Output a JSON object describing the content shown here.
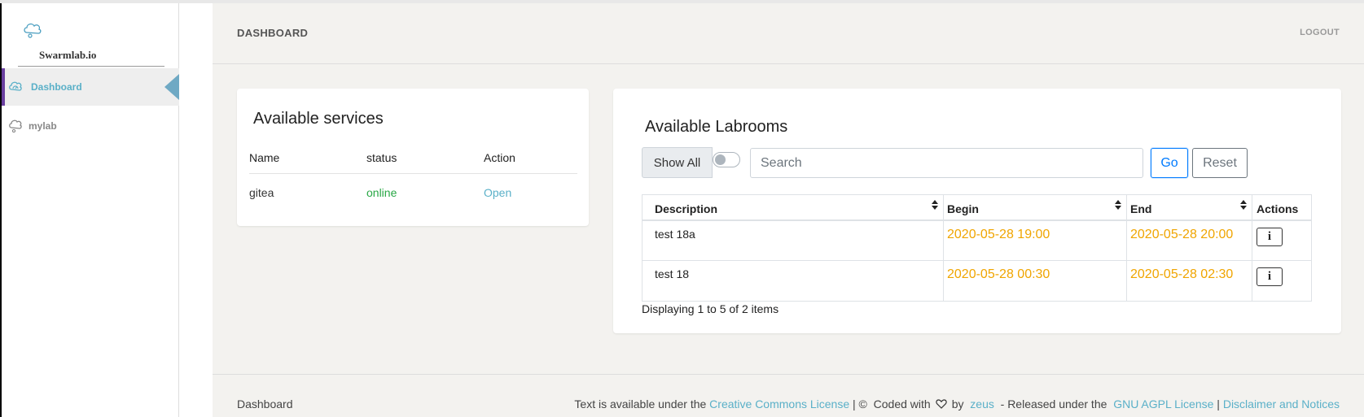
{
  "sidebar": {
    "brand": "Swarmlab.io",
    "items": [
      {
        "label": "Dashboard",
        "icon": "dashboard-icon",
        "active": true
      },
      {
        "label": "mylab",
        "icon": "cloud-icon",
        "active": false
      }
    ]
  },
  "header": {
    "title": "DASHBOARD",
    "logout": "LOGOUT"
  },
  "services": {
    "title": "Available services",
    "columns": [
      "Name",
      "status",
      "Action"
    ],
    "rows": [
      {
        "name": "gitea",
        "status": "online",
        "action": "Open"
      }
    ]
  },
  "labrooms": {
    "title": "Available Labrooms",
    "show_all": "Show All",
    "search_placeholder": "Search",
    "go": "Go",
    "reset": "Reset",
    "columns": [
      "Description",
      "Begin",
      "End",
      "Actions"
    ],
    "rows": [
      {
        "description": "test 18a",
        "begin": "2020-05-28 19:00",
        "end": "2020-05-28 20:00",
        "action": "i"
      },
      {
        "description": "test 18",
        "begin": "2020-05-28 00:30",
        "end": "2020-05-28 02:30",
        "action": "i"
      }
    ],
    "displaying": "Displaying 1 to 5 of 2 items"
  },
  "footer": {
    "left": "Dashboard",
    "text_prefix": "Text is available under the",
    "cc_link": "Creative Commons License",
    "sep1": "| ©",
    "coded_with": "Coded with",
    "by": "by",
    "author": "zeus",
    "released": "- Released under the",
    "license_link": "GNU AGPL License",
    "sep2": "|",
    "notices_link": "Disclaimer and Notices"
  },
  "colors": {
    "accent": "#5ab0c8",
    "active_bar": "#6a3fa0",
    "online": "#28a745",
    "date": "#f0a500",
    "primary": "#007bff"
  }
}
